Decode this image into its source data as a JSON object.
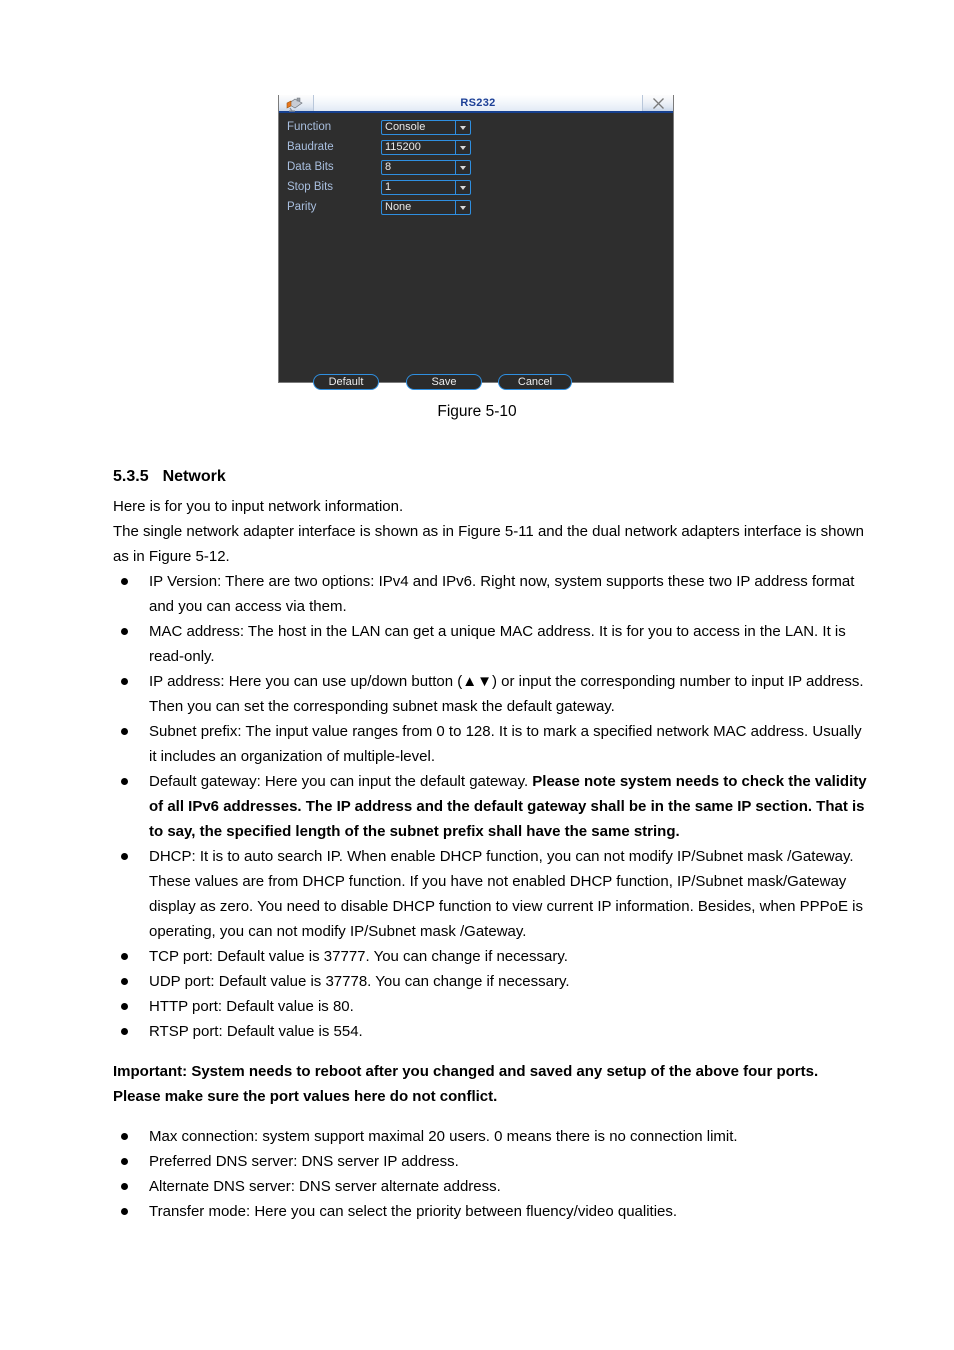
{
  "dialog": {
    "title": "RS232",
    "icon": "camera-icon",
    "close_icon": "close-icon",
    "accent_border": "#2f8fe0",
    "body_bg": "#2e2e2e",
    "label_color": "#a9bfdf",
    "title_color": "#1c3f96",
    "fields": [
      {
        "label": "Function",
        "value": "Console"
      },
      {
        "label": "Baudrate",
        "value": "115200"
      },
      {
        "label": "Data Bits",
        "value": "8"
      },
      {
        "label": "Stop Bits",
        "value": "1"
      },
      {
        "label": "Parity",
        "value": "None"
      }
    ],
    "buttons": [
      {
        "label": "Default"
      },
      {
        "label": "Save"
      },
      {
        "label": "Cancel"
      }
    ]
  },
  "figure": {
    "caption": "Figure 5-10"
  },
  "section": {
    "number": "5.3.5",
    "title": "Network"
  },
  "body": {
    "intro_1": "Here is for you to input network information.",
    "intro_2": "The single network adapter interface is shown as in Figure 5-11 and the dual network adapters interface is shown as in Figure 5-12.",
    "bullets": [
      {
        "text": "IP Version: There are two options: IPv4 and IPv6. Right now, system supports these two IP address format and you can access via them."
      },
      {
        "text": "MAC address: The host in the LAN can get a unique MAC address. It is for you to access in the LAN. It is read-only."
      },
      {
        "text": "IP address: Here you can use up/down button (▲▼) or input the corresponding number to input IP address. Then you can set the corresponding subnet mask the default gateway."
      },
      {
        "text": "Subnet prefix: The input value ranges from 0 to 128. It is to mark a specified network MAC address. Usually it includes an organization of multiple-level."
      },
      {
        "text": "Default gateway: Here you can input the default gateway. ",
        "bold_tail": "Please note system needs to check the validity of all IPv6 addresses. The IP address and the default gateway shall be in the same IP section. That is to say, the specified length of the subnet prefix shall have the same string."
      },
      {
        "text": "DHCP: It is to auto search IP. When enable DHCP function, you can not modify IP/Subnet mask /Gateway. These values are from DHCP function. If you have not enabled DHCP function, IP/Subnet mask/Gateway display as zero. You need to disable DHCP function to view current IP information.  Besides, when PPPoE is operating, you can not modify IP/Subnet mask /Gateway."
      },
      {
        "text": "TCP port: Default value is 37777. You can change if necessary."
      },
      {
        "text": "UDP port: Default value is 37778. You can change if necessary."
      },
      {
        "text": "HTTP port: Default value is 80."
      },
      {
        "text": "RTSP port: Default value is 554."
      }
    ],
    "important_note": "Important: System needs to reboot after you changed and saved any setup of the above four ports. Please make sure the port values here do not conflict.",
    "bullets_tail": [
      {
        "text": "Max connection: system support maximal 20 users. 0 means there is no connection limit."
      },
      {
        "text": "Preferred DNS server: DNS server IP address."
      },
      {
        "text": "Alternate DNS server: DNS server alternate address."
      },
      {
        "text": "Transfer mode: Here you can select the priority between fluency/video qualities."
      }
    ]
  }
}
